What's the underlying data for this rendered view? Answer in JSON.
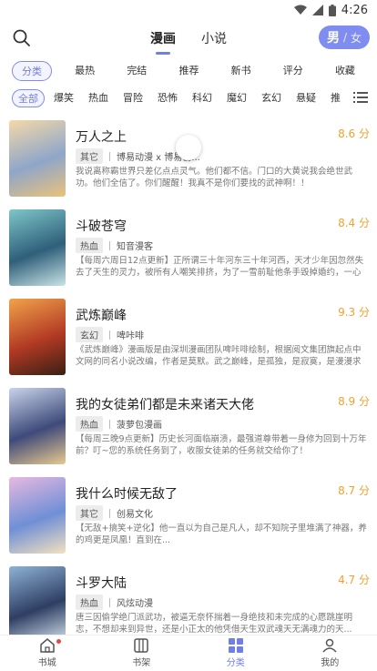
{
  "status_bar": {
    "time": "4:26"
  },
  "header": {
    "tabs": [
      {
        "label": "漫画",
        "active": true
      },
      {
        "label": "小说",
        "active": false
      }
    ],
    "gender": {
      "selected": "男",
      "separator": "/",
      "other": "女"
    }
  },
  "sort_filters": [
    {
      "label": "分类",
      "active": true
    },
    {
      "label": "最热",
      "active": false
    },
    {
      "label": "完结",
      "active": false
    },
    {
      "label": "推荐",
      "active": false
    },
    {
      "label": "新书",
      "active": false
    },
    {
      "label": "评分",
      "active": false
    },
    {
      "label": "收藏",
      "active": false
    }
  ],
  "genre_filters": [
    {
      "label": "全部",
      "active": true
    },
    {
      "label": "爆笑"
    },
    {
      "label": "热血"
    },
    {
      "label": "冒险"
    },
    {
      "label": "恐怖"
    },
    {
      "label": "科幻"
    },
    {
      "label": "魔幻"
    },
    {
      "label": "玄幻"
    },
    {
      "label": "悬疑"
    },
    {
      "label": "推"
    }
  ],
  "items": [
    {
      "title": "万人之上",
      "score": "8.6 分",
      "tag": "其它",
      "author": "博易动漫 x 博易创...",
      "desc": "我说离称霸世界只差亿点点灵气。他们都不信。门口的大黄说我会绝世武功。他们全信了。你们醒醒！我真不是你们要找的武神啊！！",
      "cover": [
        "#f4d9a8",
        "#8fa6c9",
        "#e9c37a"
      ]
    },
    {
      "title": "斗破苍穹",
      "score": "8.4 分",
      "tag": "热血",
      "author": "知音漫客",
      "desc": "【每周六周日12点更新】正所谓三十年河东三十年河西，天才少年因忽然失去了天生的灵力，被所有人嘲笑排挤，为了一雪前耻他条手毁掉婚约，一心进修、...",
      "cover": [
        "#7ec6c9",
        "#2f5f7a",
        "#c9e4e6"
      ]
    },
    {
      "title": "武炼巅峰",
      "score": "9.3 分",
      "tag": "玄幻",
      "author": "啤咔啡",
      "desc": "《武炼巅峰》漫画版是由深圳漫画团队啤咔啡绘制，根据阅文集团旗起点中文网的同名小说改编，作者是莫默。武之巅峰，是孤独，是寂寞，是漫漫求索，是...",
      "cover": [
        "#f0a34a",
        "#b23a24",
        "#3a1f14"
      ]
    },
    {
      "title": "我的女徒弟们都是未来诸天大佬",
      "score": "8.9 分",
      "tag": "热血",
      "author": "菠萝包漫画",
      "desc": "【每周三晚9点更新】历史长河面临崩溃，最强道尊带着一身修为回到十万年前？叮~您的系统任务到了，收服女徒弟的任务就交给你了！",
      "cover": [
        "#c9d4ea",
        "#3e4a7a",
        "#e8c98f"
      ]
    },
    {
      "title": "我什么时候无敌了",
      "score": "8.7 分",
      "tag": "其它",
      "author": "创易文化",
      "desc": "【无敌+搞笑+逆化】他一直以为自己是凡人，却不知院子里堆满了神器，养的鸡更是凤凰！直到在...",
      "cover": [
        "#e7b9e0",
        "#6f8fd6",
        "#f3e2c0"
      ]
    },
    {
      "title": "斗罗大陆",
      "score": "4.7 分",
      "tag": "热血",
      "author": "风炫动漫",
      "desc": "唐三因偷学绝门派武功，被逼无奈怀揣着一身绝技和未完成的心愿跳崖明志，不想却来到异世，还是小正太的他凭借天生双武魂天无满魂力的天...",
      "cover": [
        "#8fb2d6",
        "#2e3e63",
        "#d8e6ef"
      ]
    }
  ],
  "bottom_nav": [
    {
      "label": "书城",
      "icon": "home-icon",
      "active": false,
      "dot": true
    },
    {
      "label": "书架",
      "icon": "bookshelf-icon",
      "active": false,
      "dot": false
    },
    {
      "label": "分类",
      "icon": "category-grid-icon",
      "active": true,
      "dot": false
    },
    {
      "label": "我的",
      "icon": "person-icon",
      "active": false,
      "dot": false
    }
  ],
  "colors": {
    "accent": "#7f8cf0",
    "score": "#f4a12c",
    "badge_dot": "#e84545"
  }
}
